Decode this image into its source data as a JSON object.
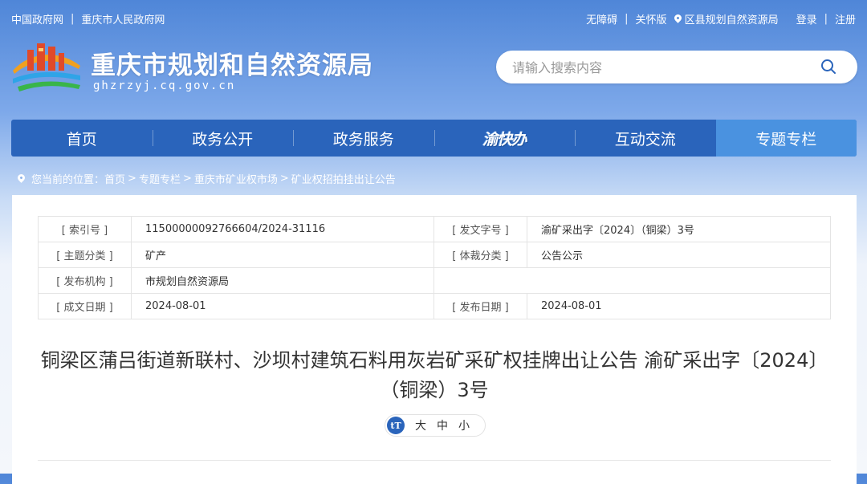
{
  "topbar": {
    "links_left": [
      "中国政府网",
      "重庆市人民政府网"
    ],
    "accessibility": "无障碍",
    "elder_mode": "关怀版",
    "district": "区县规划自然资源局",
    "login": "登录",
    "register": "注册",
    "separator": "|"
  },
  "header": {
    "title": "重庆市规划和自然资源局",
    "domain": "ghzrzyj.cq.gov.cn"
  },
  "search": {
    "placeholder": "请输入搜索内容"
  },
  "nav": {
    "items": [
      "首页",
      "政务公开",
      "政务服务",
      "渝快办",
      "互动交流",
      "专题专栏"
    ],
    "active": "专题专栏"
  },
  "breadcrumb": {
    "prefix": "您当前的位置：",
    "items": [
      "首页",
      "专题专栏",
      "重庆市矿业权市场",
      "矿业权招拍挂出让公告"
    ],
    "separator": ">"
  },
  "meta": {
    "index_label": "[ 索引号 ]",
    "index_value": "11500000092766604/2024-31116",
    "doc_no_label": "[ 发文字号 ]",
    "doc_no_value": "渝矿采出字〔2024〕（铜梁）3号",
    "topic_label": "[ 主题分类 ]",
    "topic_value": "矿产",
    "genre_label": "[ 体裁分类 ]",
    "genre_value": "公告公示",
    "issuer_label": "[ 发布机构 ]",
    "issuer_value": "市规划自然资源局",
    "created_label": "[ 成文日期 ]",
    "created_value": "2024-08-01",
    "published_label": "[ 发布日期 ]",
    "published_value": "2024-08-01"
  },
  "article": {
    "title": "铜梁区蒲吕街道新联村、沙坝村建筑石料用灰岩矿采矿权挂牌出让公告 渝矿采出字〔2024〕（铜梁）3号"
  },
  "font_size": {
    "icon": "tT",
    "options": [
      "大",
      "中",
      "小"
    ]
  },
  "colors": {
    "nav_bg": "#2a64bb",
    "nav_active": "#4a92e0",
    "header_gradient_top": "#4f86d8"
  }
}
